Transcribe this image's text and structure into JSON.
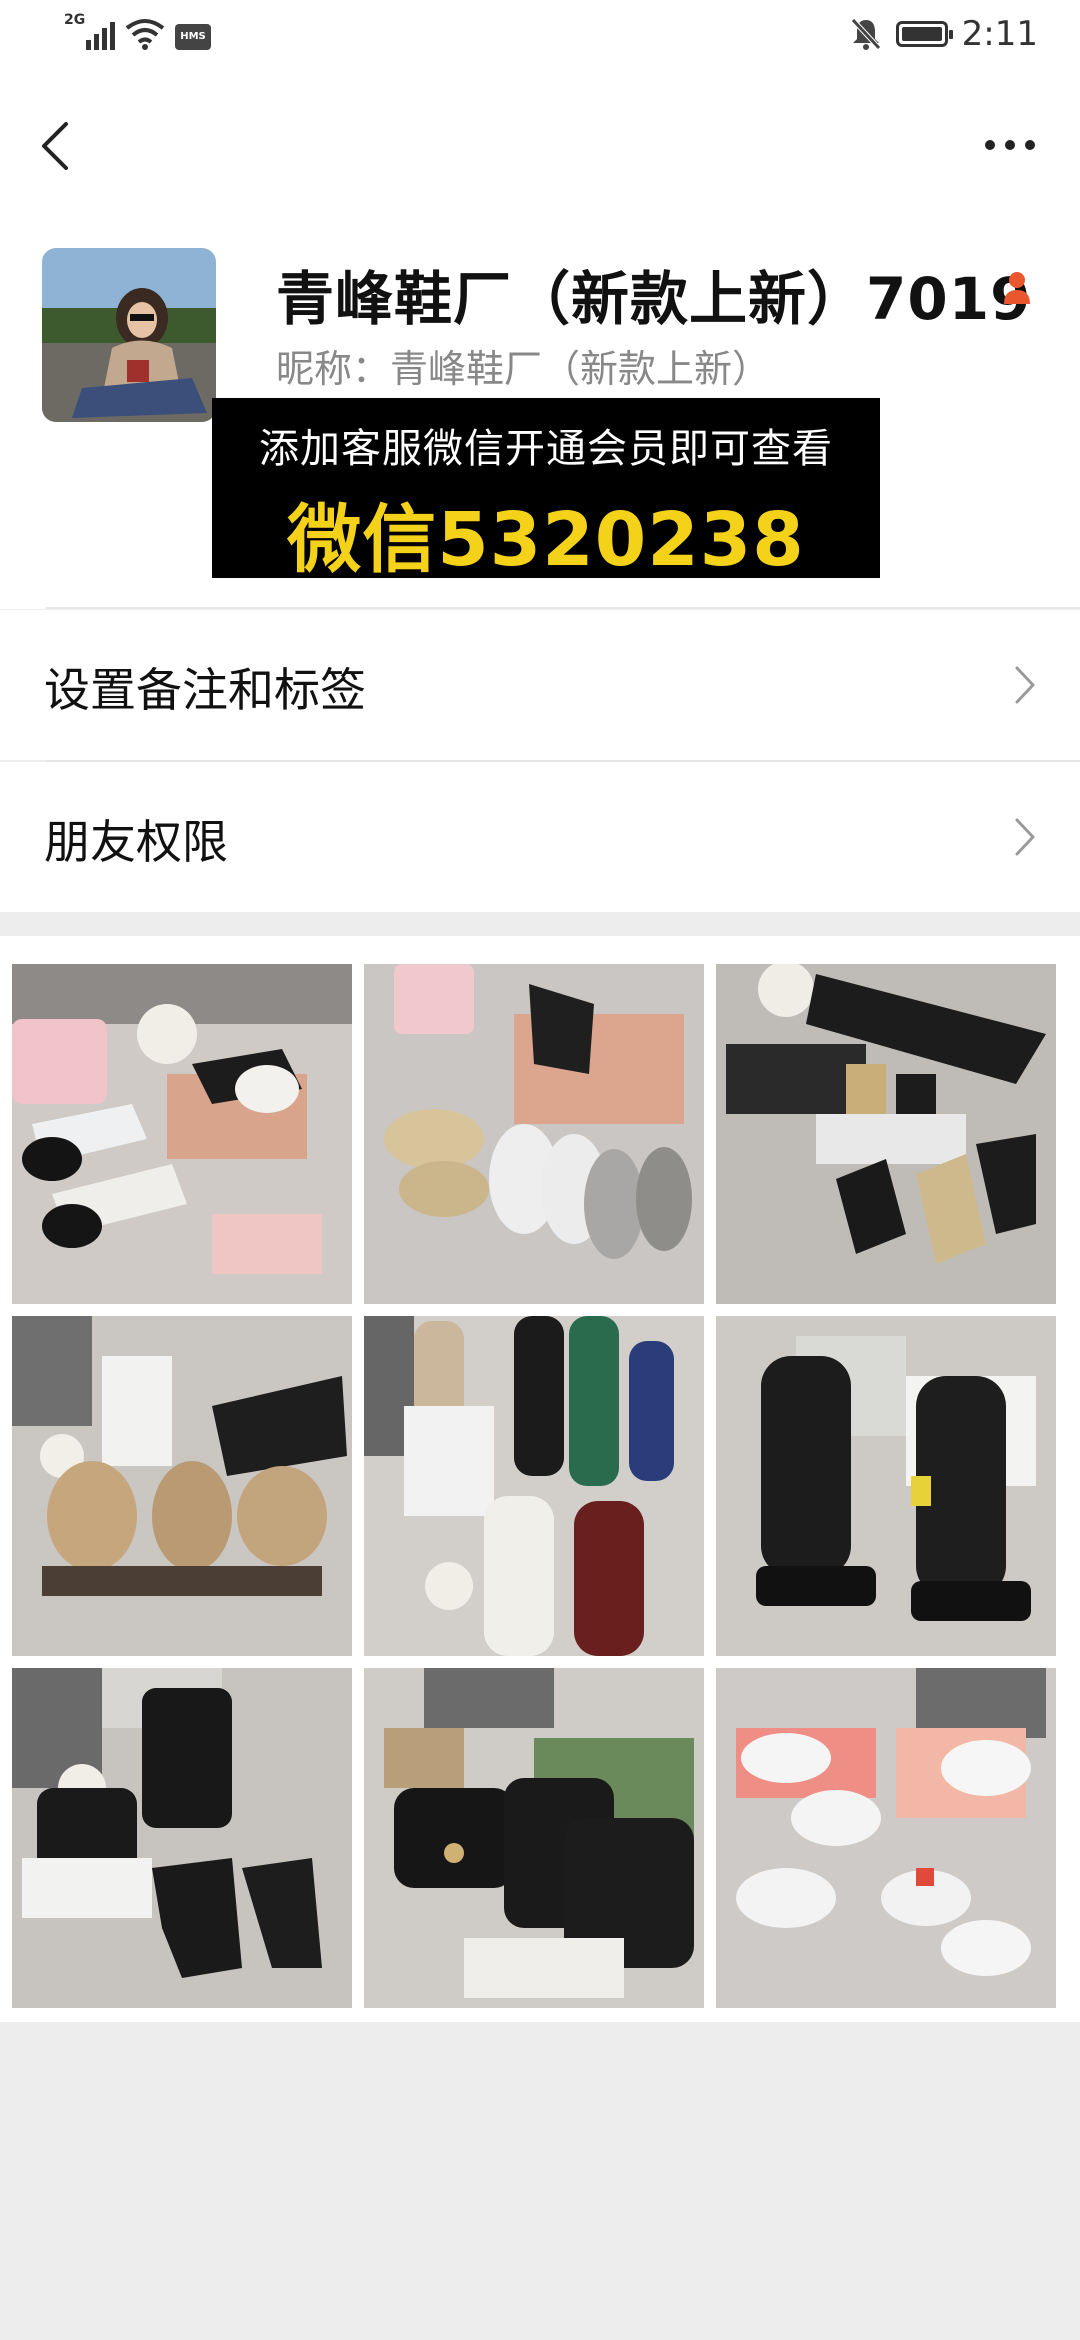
{
  "status_bar": {
    "network": "2G",
    "hms": "HMS",
    "time": "2:11",
    "icons": [
      "signal-icon",
      "wifi-icon",
      "hms-icon",
      "mute-icon",
      "battery-icon"
    ]
  },
  "nav": {
    "back_icon": "back-chevron-icon",
    "more_icon": "more-dots-icon"
  },
  "profile": {
    "display_name": "青峰鞋厂（新款上新）7019",
    "nickname": "昵称：青峰鞋厂（新款上新）",
    "gender_icon": "person-icon",
    "gender_color": "#e9572f"
  },
  "banner": {
    "line1": "添加客服微信开通会员即可查看",
    "line2": "微信5320238",
    "line2_color": "#f5d21a"
  },
  "menu": [
    {
      "label": "设置备注和标签"
    },
    {
      "label": "朋友权限"
    }
  ],
  "album": {
    "photo_count": 9
  }
}
